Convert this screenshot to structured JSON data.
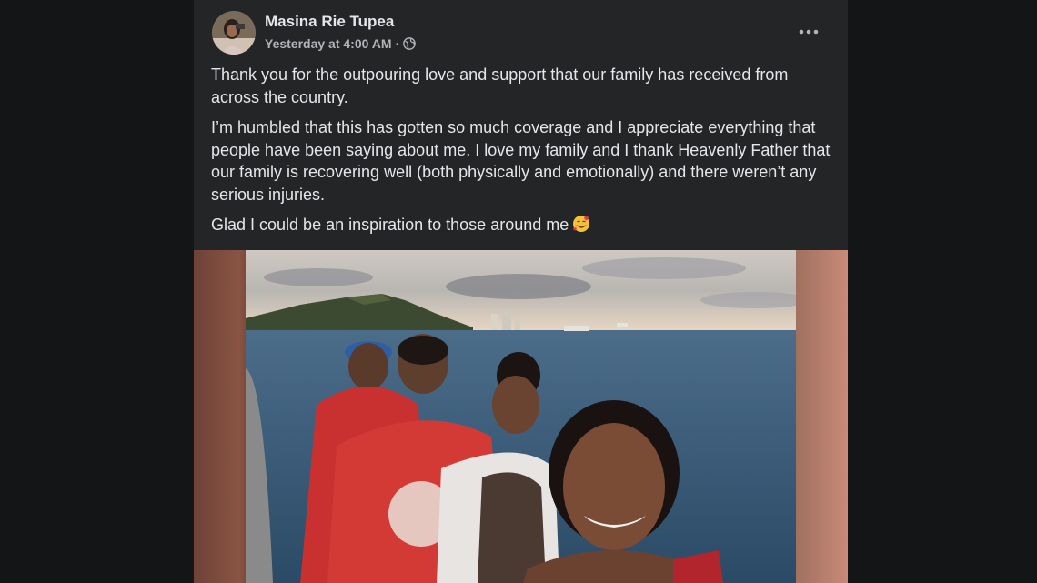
{
  "post": {
    "author": "Masina Rie Tupea",
    "timestamp": "Yesterday at 4:00 AM",
    "separator": "·",
    "privacy_icon": "globe-icon",
    "more_icon": "more-horizontal-icon",
    "paragraphs": [
      "Thank you for the outpouring love and support that our family has received from across the country.",
      "I’m humbled that this has gotten so much coverage and I appreciate everything that people have been saying about me. I love my family and I thank Heavenly Father that our family is recovering well (both physically and emotionally) and there weren’t any serious injuries.",
      "Glad I could be an inspiration to those around me"
    ],
    "emoji_icon": "smiling-face-with-hearts-emoji"
  },
  "colors": {
    "background": "#141516",
    "card": "#242526",
    "primary_text": "#e4e6eb",
    "secondary_text": "#b0b3b8"
  }
}
